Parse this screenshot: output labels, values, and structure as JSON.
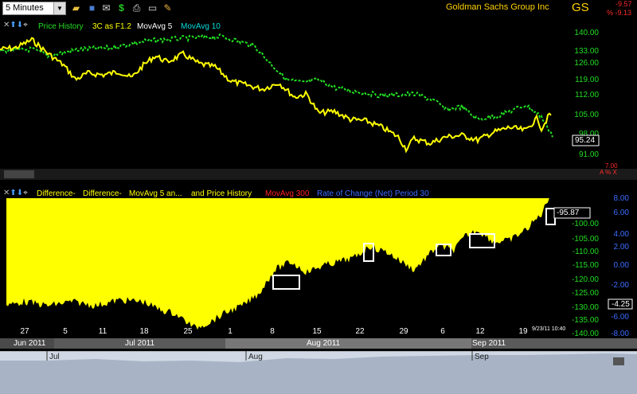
{
  "toolbar": {
    "interval": "5 Minutes",
    "company": "Goldman Sachs Group Inc",
    "ticker": "GS",
    "change_value": "-9.57",
    "change_percent": "% -9.13",
    "icons": [
      "folder-icon",
      "save-icon",
      "email-icon",
      "dollar-icon",
      "print-icon",
      "display-icon",
      "pencil-icon"
    ]
  },
  "upper_panel": {
    "legend": {
      "price_history": "Price History",
      "three_c": "3C as F1.2",
      "movavg5": "MovAvg 5",
      "movavg10": "MovAvg 10"
    },
    "y_ticks": [
      "140.00",
      "133.00",
      "126.00",
      "119.00",
      "112.00",
      "105.00",
      "98.00",
      "91.00"
    ],
    "last_price": "95.24",
    "small_value": "7.00",
    "small_controls": "A % X"
  },
  "lower_panel": {
    "legend": {
      "difference1": "Difference-",
      "difference2": "Difference-",
      "movavg_an": "MovAvg 5 an...",
      "and_price": "and  Price History",
      "movavg300": "MovAvg 300",
      "roc": "Rate of Change (Net) Period 30"
    },
    "left_ticks": [
      "-95.00",
      "-100.00",
      "-105.00",
      "-110.00",
      "-115.00",
      "-120.00",
      "-125.00",
      "-130.00",
      "-135.00",
      "-140.00"
    ],
    "right_ticks": [
      "8.00",
      "6.00",
      "4.00",
      "2.00",
      "0.00",
      "-2.00",
      "-4.00",
      "-6.00",
      "-8.00"
    ],
    "current_value": "-95.87",
    "roc_value": "-4.25"
  },
  "x_axis": {
    "ticks": [
      "27",
      "5",
      "11",
      "18",
      "25",
      "1",
      "8",
      "15",
      "22",
      "29",
      "6",
      "12",
      "19"
    ],
    "timestamp": "9/23/11 10:40",
    "months": [
      "Jun 2011",
      "Jul 2011",
      "Aug 2011",
      "Sep 2011"
    ],
    "nav_months": [
      "Jul",
      "Aug",
      "Sep"
    ]
  },
  "colors": {
    "price": "#ffff00",
    "three_c": "#22dd22",
    "movavg5": "#ffffff",
    "movavg10": "#00dddd",
    "difference": "#ffff00",
    "movavg300": "#ff2222",
    "roc": "#3b6cff",
    "axis_text": "#22dd22"
  }
}
